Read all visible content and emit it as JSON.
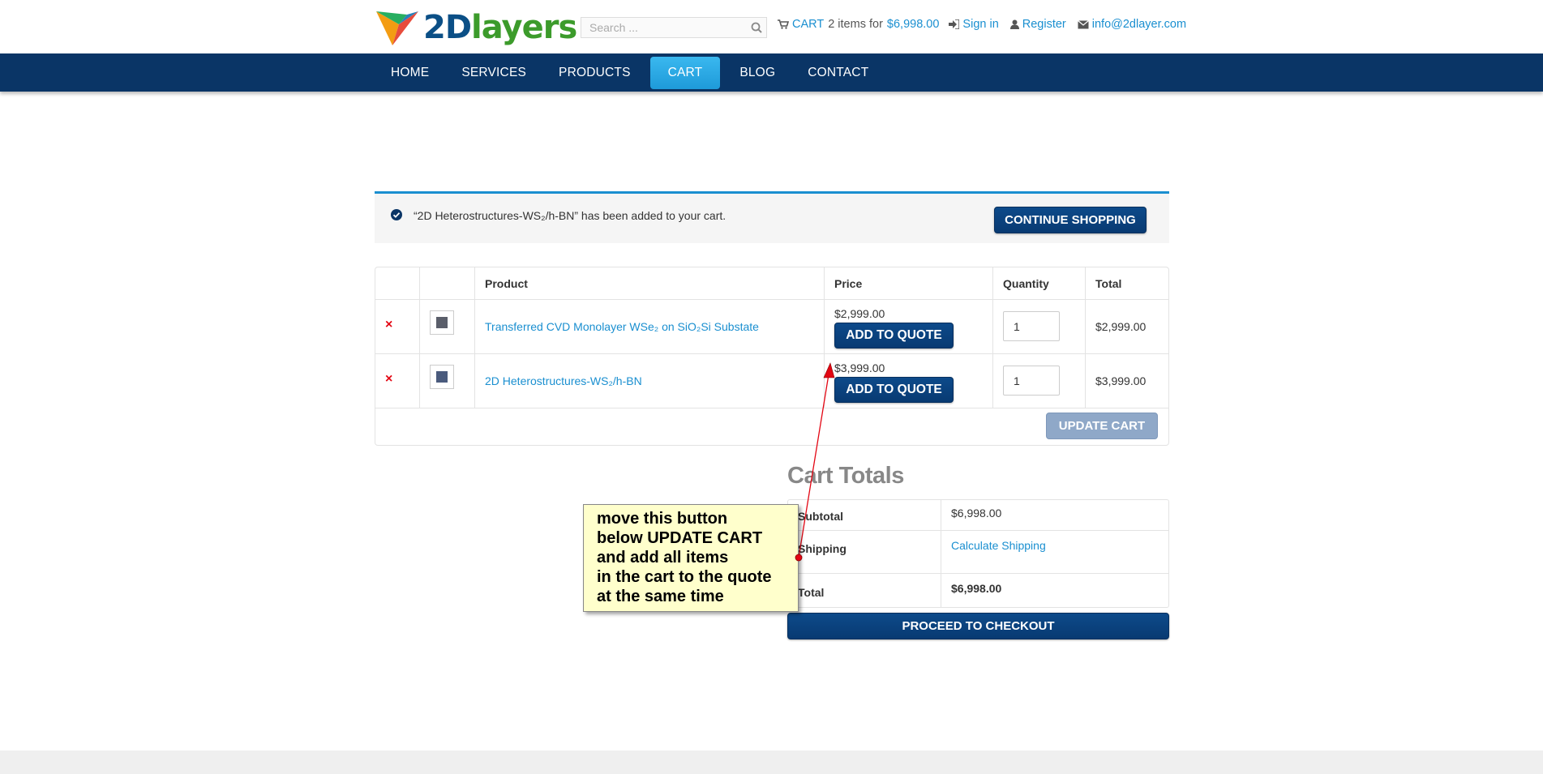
{
  "header": {
    "logo_2d": "2D",
    "logo_layers": "layers",
    "search_placeholder": "Search ...",
    "cart_link": "CART",
    "cart_summary": "2 items for",
    "cart_amount": "$6,998.00",
    "sign_in": "Sign in",
    "register": "Register",
    "email": "info@2dlayer.com"
  },
  "nav": {
    "items": [
      "HOME",
      "SERVICES",
      "PRODUCTS",
      "CART",
      "BLOG",
      "CONTACT"
    ],
    "active": "CART"
  },
  "notice": {
    "message": "“2D Heterostructures-WS₂/h-BN” has been added to your cart.",
    "button": "CONTINUE SHOPPING"
  },
  "cart": {
    "headers": {
      "product": "Product",
      "price": "Price",
      "quantity": "Quantity",
      "total": "Total"
    },
    "rows": [
      {
        "remove": "×",
        "product": "Transferred CVD Monolayer WSe₂ on SiO₂Si Substate",
        "price": "$2,999.00",
        "quote_button": "ADD TO QUOTE",
        "quantity": "1",
        "total": "$2,999.00"
      },
      {
        "remove": "×",
        "product": "2D Heterostructures-WS₂/h-BN",
        "price": "$3,999.00",
        "quote_button": "ADD TO QUOTE",
        "quantity": "1",
        "total": "$3,999.00"
      }
    ],
    "update_button": "UPDATE CART"
  },
  "totals": {
    "title": "Cart Totals",
    "subtotal_label": "Subtotal",
    "subtotal_value": "$6,998.00",
    "shipping_label": "Shipping",
    "shipping_value": "Calculate Shipping",
    "total_label": "Total",
    "total_value": "$6,998.00",
    "checkout_button": "PROCEED TO CHECKOUT"
  },
  "annotation": {
    "lines": [
      "move this button",
      "below UPDATE CART",
      "and add all items",
      "in the cart to the quote",
      "at the same time"
    ]
  },
  "colors": {
    "nav_bg": "#0a3566",
    "accent": "#1a8fd0",
    "active_tab": "#2aa8e4",
    "remove": "#e30613",
    "callout_bg": "#ffffcc",
    "arrow": "#e30613"
  }
}
